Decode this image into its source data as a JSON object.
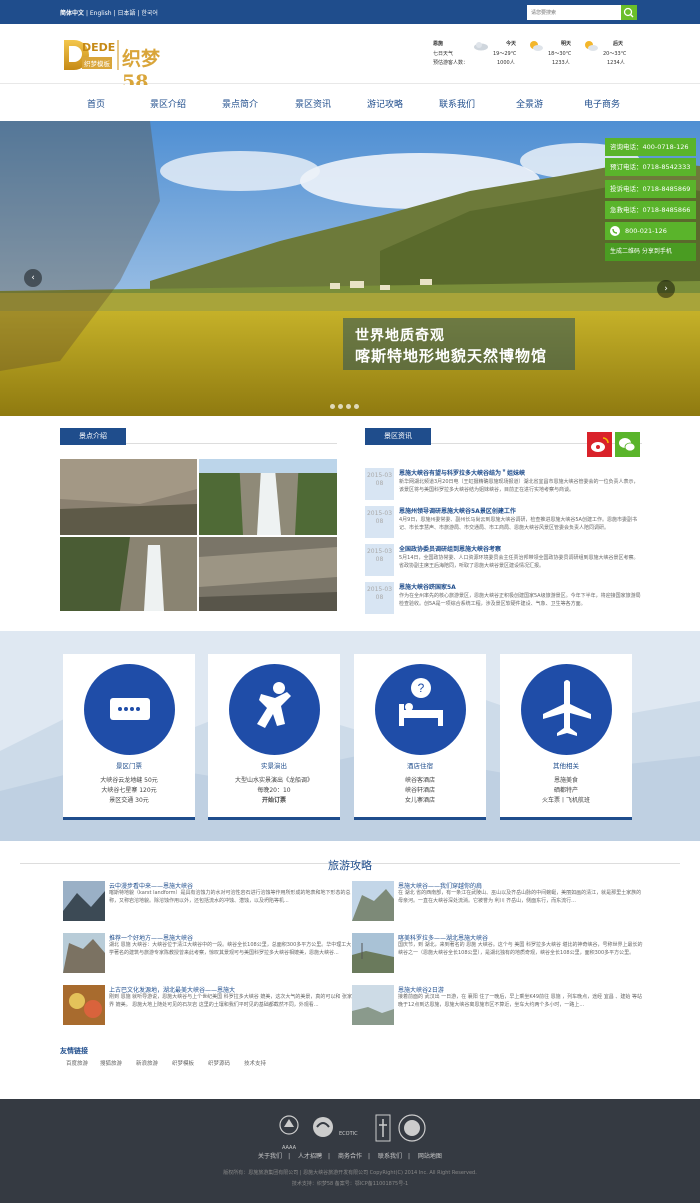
{
  "topbar": {
    "languages": [
      "简体中文",
      "English",
      "日本語",
      "한국어"
    ],
    "separator": "|",
    "search_placeholder": "请您要搜索",
    "search_icon": "search-icon"
  },
  "header": {
    "logo_text": "DEDE",
    "logo_sub": "织梦58",
    "logo_tag": "织梦模板",
    "weather": {
      "location": "恩施",
      "label1": "七日天气",
      "label2": "预估游客人数：",
      "days": [
        {
          "day": "今天",
          "temp": "19～29℃",
          "visitors": "1000人"
        },
        {
          "day": "明天",
          "temp": "18～30℃",
          "visitors": "1233人"
        },
        {
          "day": "后天",
          "temp": "20～33℃",
          "visitors": "1234人"
        }
      ]
    }
  },
  "nav": [
    "首页",
    "景区介绍",
    "景点简介",
    "景区资讯",
    "游记攻略",
    "联系我们",
    "全景游",
    "电子商务"
  ],
  "banner": {
    "line1": "世界地质奇观",
    "line2": "喀斯特地形地貌天然博物馆",
    "arrow_left": "‹",
    "arrow_right": "›",
    "phones": [
      "咨询电话：400-0718-126",
      "预订电话：0718-8542333",
      "投诉电话：0718-8485869",
      "急救电话：0718-8485866",
      "800-021-126",
      "生成二维码 分享到手机"
    ]
  },
  "scenic": {
    "title": "景点介绍"
  },
  "newsbox": {
    "title": "景区资讯",
    "items": [
      {
        "date": "2015-03",
        "day": "08",
        "title": "恩施大峡谷有望与科罗拉多大峡谷结为＂姐妹峡",
        "desc": "新华网湖北频道3月20日电（王虹摄精确恩施现场报道）湖北省宜昌市恩施大峡谷管委会的一位负责人表示，该景区将与美国科罗拉多大峡谷结为姐妹峡谷，目前正在进行实地考察与商谈。"
      },
      {
        "date": "2015-03",
        "day": "08",
        "title": "恩施州领导调研恩施大峡谷5A景区创建工作",
        "desc": "4月9日，恩施州委常委、副州长马尚云到恩施大峡谷调研，检查推进恩施大峡谷5A创建工作。恩施市委副书记、市长李慧声、市旅游局、市交通局、市工商局、恩施大峡谷风景区管委会负责人陪同调研。"
      },
      {
        "date": "2015-03",
        "day": "08",
        "title": "全国政协委员调研组到恩施大峡谷考察",
        "desc": "5月14日，全国政协常委、人口资源环境委员会主任贾治邦带领全国政协委员调研组到恩施大峡谷景区考察。省政协副主席王后海陪同，听取了恩施大峡谷景区建设情况汇报。"
      },
      {
        "date": "2015-03",
        "day": "08",
        "title": "恩施大峡谷跻国家5A",
        "desc": "作为在全州率先的核心旅游景区，恩施大峡谷正积极创建国家5A级旅游景区。今年下半年，将迎接国家旅游局检查验收。创5A是一项综合系统工程，涉及景区软硬件建设、气象、卫生等各方面。"
      }
    ]
  },
  "services": [
    {
      "title": "景区门票",
      "lines": [
        "大峡谷云龙地缝 50元",
        "大峡谷七星寨 120元",
        "景区交通 30元"
      ],
      "icon": "ticket-icon"
    },
    {
      "title": "实景演出",
      "lines": [
        "大型山水实景演出《龙船调》",
        "每晚20：10",
        "开始订票"
      ],
      "icon": "dancer-icon"
    },
    {
      "title": "酒店住宿",
      "lines": [
        "峡谷客酒店",
        "峡谷轩酒店",
        "女儿寨酒店"
      ],
      "icon": "hotel-bed-icon"
    },
    {
      "title": "其他相关",
      "lines": [
        "恩施美食",
        "硒都特产",
        "火车票丨飞机航班"
      ],
      "icon": "airplane-icon"
    }
  ],
  "guides": {
    "title": "旅游攻略",
    "items": [
      {
        "title": "云中漫步看中来——恩施大峡谷",
        "desc": "喀斯特地貌（karst landform）是具有溶蚀力的水对可溶性岩石进行溶蚀等作用所形成的地表和地下形态的总称，又称岩溶地貌。除溶蚀作用以外，还包括流水的冲蚀、潜蚀，以及坍陷等机..."
      },
      {
        "title": "恩施大峡谷——我们穿越你的肩",
        "desc": "在 湖北 省的西南部，有一条江在武陵山、巫山以及齐岳山脉的中间蜿蜒，美丽如画的清江，就是那里土家族的母亲河。一直在大峡谷深处流淌。它被誉为 利川 齐岳山，侧面东行，而东流行..."
      },
      {
        "title": "推荐一个好地方——恩施大峡谷",
        "desc": "湖北 恩施 大峡谷：大峡谷位于清江大峡谷中的一段。峡谷全长108公里，总面积300多平方公里。华中理工大学著名的建筑与旅游专家陈教授曾来此考察，惊叹其景观可与美国科罗拉多大峡谷相媲美，恩施大峡谷..."
      },
      {
        "title": "喀美科罗拉多——湖北恩施大峡谷",
        "desc": "国庆节，到 湖北，来到著名的 恩施 大峡谷。这个与 美国 科罗拉多大峡谷 堪比的神奇峡谷，号称世界上最长的峡谷之一（恩施大峡谷全长108公里），是湖北独有的地质奇观，峡谷全长108公里，面积300多平方公里。"
      },
      {
        "title": "上古巴文化发源地，湖北最美大峡谷——恩施大",
        "desc": "刚到 恩施 就听导游说，恩施大峡谷与上个世纪美国 科罗拉多大峡谷 媲美，这次大气的美景，真的可以和 张家界 媲美。 恩施大地上随处可见的石灰岩 这里的土壤和我们平时见的基础都截然不同，外观看..."
      },
      {
        "title": "恩施大峡谷2日游",
        "desc": "接着前面的 武汉出 一日游，在 襄阳 住了一晚后，早上乘坐K49前往 恩施 ，列车晚点，途经 宜昌 、建始 等站晚于12点到达恩施，恩施大峡谷离恩施市区不算近，坐车大约两个多小时，一路上..."
      }
    ]
  },
  "friendlinks": {
    "title": "友情链接",
    "items": [
      "百度旅游",
      "搜狐旅游",
      "新浪旅游",
      "织梦模板",
      "织梦源码",
      "技术支持"
    ]
  },
  "footer": {
    "logos": [
      "AAAA",
      "ECOTIC",
      "全国旅游",
      "景区"
    ],
    "nav": [
      "关于我们",
      "人才招聘",
      "商务合作",
      "联系我们",
      "网站地图"
    ],
    "separator": "|",
    "copy1": "版权所有：恩施旅游集团有限公司 | 恩施大峡谷旅游开发有限公司 CopyRight(C) 2014 Inc. All Right Reserved.",
    "copy2": "技术支持：织梦58 备案号：鄂ICP备11001875号-1"
  },
  "colors": {
    "brand": "#1f4d8c",
    "green": "#5ab42b",
    "footer": "#353a42"
  }
}
